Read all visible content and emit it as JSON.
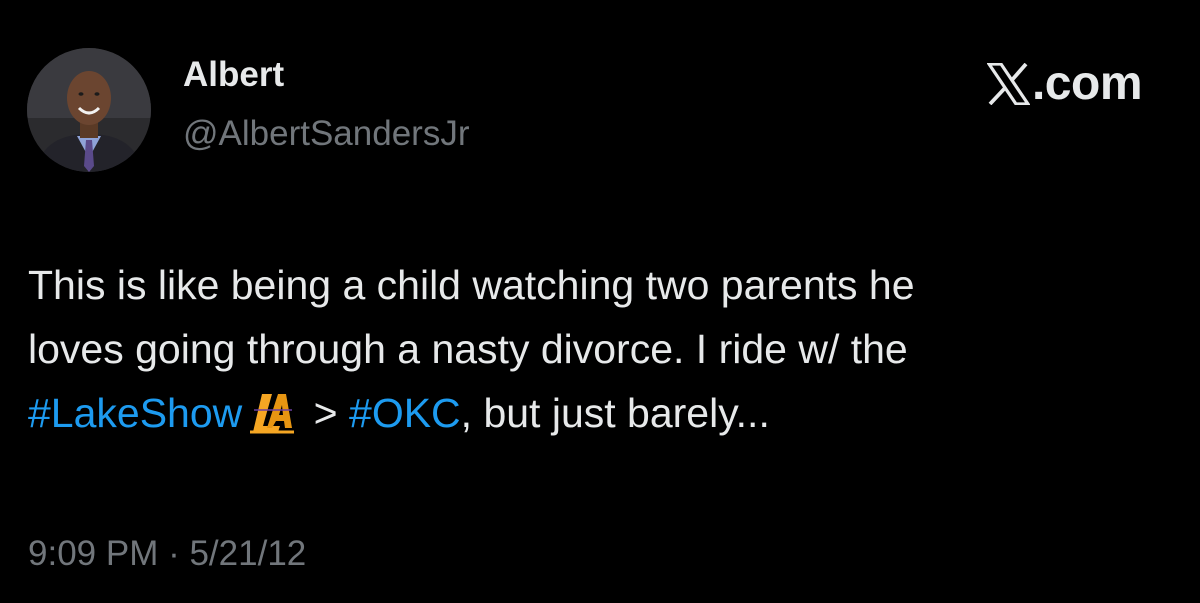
{
  "tweet": {
    "author": {
      "display_name": "Albert",
      "handle": "@AlbertSandersJr",
      "avatar_icon": "profile-photo"
    },
    "brand": {
      "icon": "x-logo-icon",
      "suffix": ".com"
    },
    "body": {
      "line1": "This is like being a child watching two parents he",
      "line2": "loves going through a nasty divorce. I ride w/ the",
      "line3": {
        "hashtag1": "#LakeShow",
        "emoji_icon": "lakers-la-logo-icon",
        "gt": " > ",
        "hashtag2": "#OKC",
        "rest": ", but just barely..."
      }
    },
    "timestamp": {
      "time": "9:09 PM",
      "separator": " · ",
      "date": "5/21/12"
    }
  },
  "colors": {
    "background": "#000000",
    "text": "#e7e9ea",
    "muted": "#71767b",
    "link": "#1d9bf0",
    "lakers_gold": "#f5a623"
  }
}
